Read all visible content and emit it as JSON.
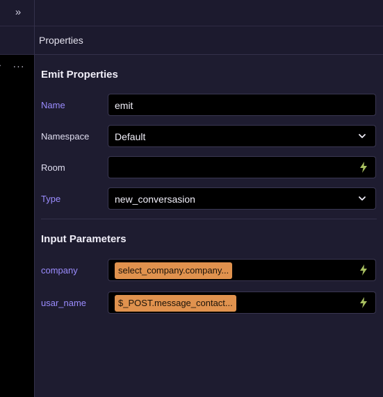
{
  "sidebar": {
    "expand_icon": "chevrons-right-icon",
    "more_label": "···",
    "partial_label": "›"
  },
  "header": {
    "title": "Properties"
  },
  "emit_section": {
    "title": "Emit Properties",
    "fields": {
      "name": {
        "label": "Name",
        "value": "emit"
      },
      "namespace": {
        "label": "Namespace",
        "value": "Default"
      },
      "room": {
        "label": "Room",
        "value": ""
      },
      "type": {
        "label": "Type",
        "value": "new_conversasion"
      }
    }
  },
  "input_section": {
    "title": "Input Parameters",
    "params": [
      {
        "label": "company",
        "value": "select_company.company..."
      },
      {
        "label": "usar_name",
        "value": "$_POST.message_contact..."
      }
    ]
  },
  "colors": {
    "accent_label": "#9b8cff",
    "chip": "#e0924e",
    "bolt": "#a8c060",
    "field_bg": "#000000",
    "panel_bg": "#1e1c30"
  }
}
